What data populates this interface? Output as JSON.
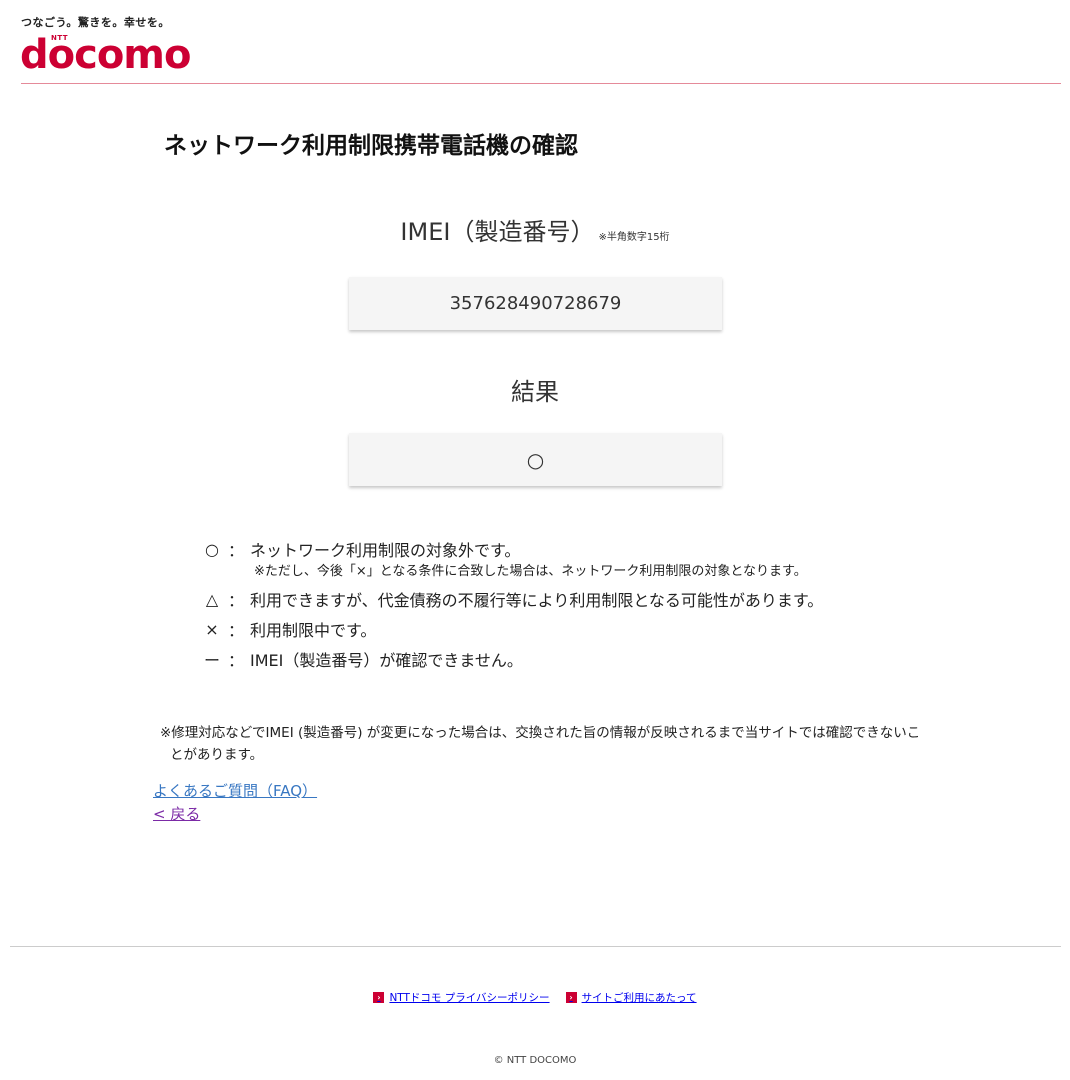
{
  "header": {
    "tagline": "つなごう。驚きを。幸せを。",
    "logo_ntt": "NTT",
    "logo_word": "docomo"
  },
  "page": {
    "title": "ネットワーク利用制限携帯電話機の確認"
  },
  "imei": {
    "label": "IMEI（製造番号）",
    "note": "※半角数字15桁",
    "value": "357628490728679"
  },
  "result": {
    "label": "結果",
    "value": "○"
  },
  "legend": {
    "items": [
      {
        "symbol": "○",
        "colon": "：",
        "text": "ネットワーク利用制限の対象外です。"
      },
      {
        "symbol": "△",
        "colon": "：",
        "text": "利用できますが、代金債務の不履行等により利用制限となる可能性があります。"
      },
      {
        "symbol": "×",
        "colon": "：",
        "text": "利用制限中です。"
      },
      {
        "symbol": "ー",
        "colon": "：",
        "text": "IMEI（製造番号）が確認できません。"
      }
    ],
    "sub_note": "※ただし、今後「×」となる条件に合致した場合は、ネットワーク利用制限の対象となります。"
  },
  "footnote": "※修理対応などでIMEI (製造番号) が変更になった場合は、交換された旨の情報が反映されるまで当サイトでは確認できないことがあります。",
  "links": {
    "faq": "よくあるご質問（FAQ）",
    "back": "< 戻る"
  },
  "footer": {
    "privacy": "NTTドコモ プライバシーポリシー",
    "terms": "サイトご利用にあたって",
    "arrow_glyph": "›",
    "copyright": "© NTT DOCOMO"
  },
  "colors": {
    "brand": "#cc0033",
    "link": "#3877c2",
    "visited_link": "#7b2aa6"
  }
}
